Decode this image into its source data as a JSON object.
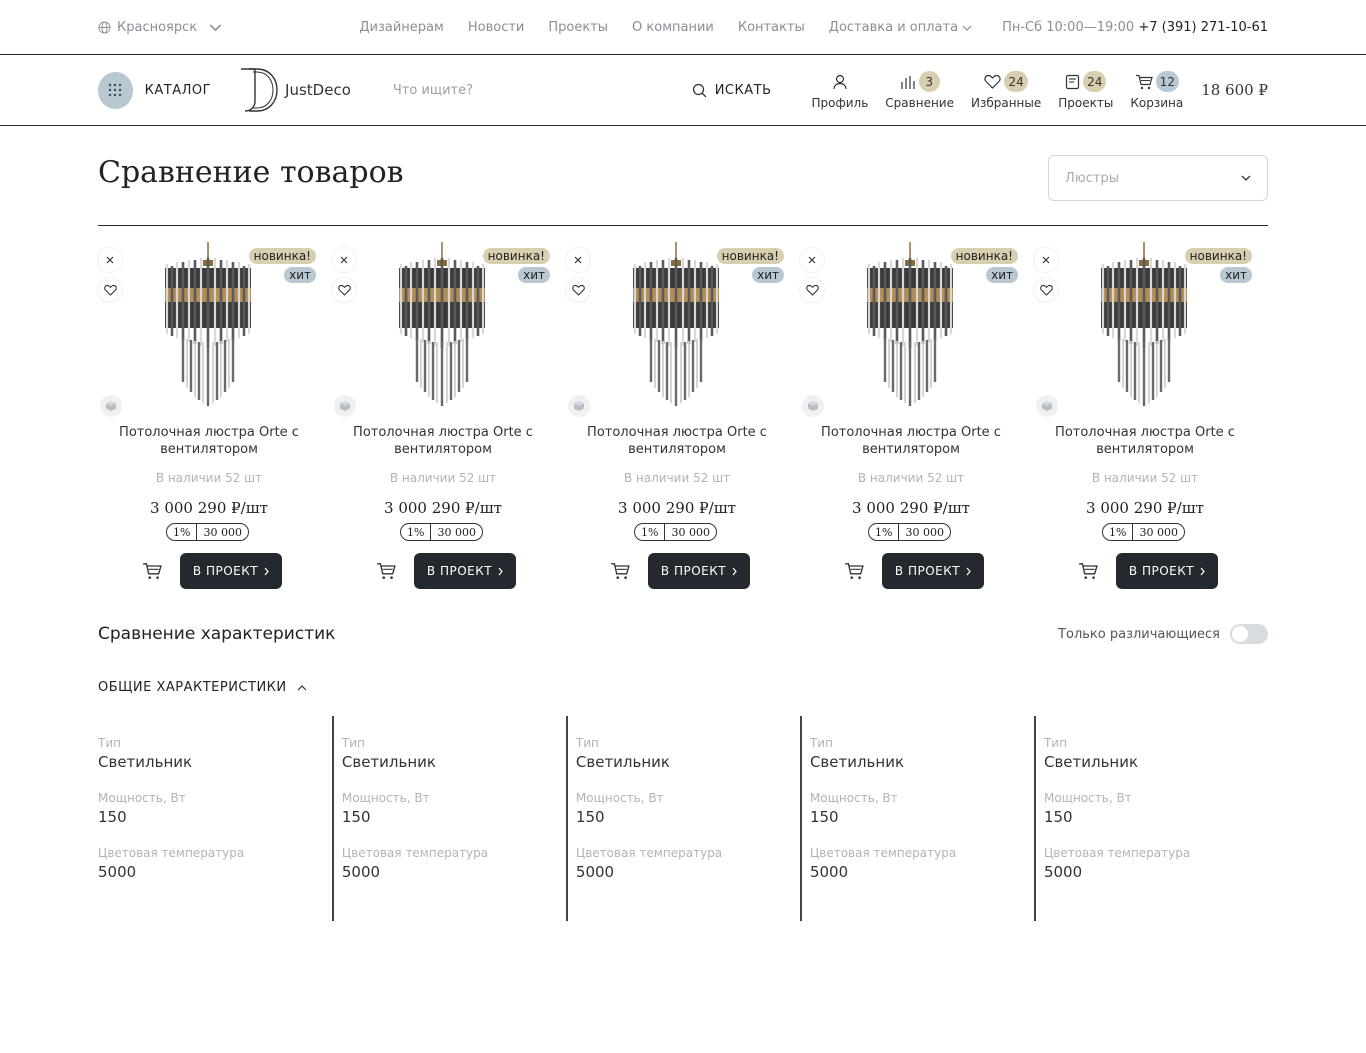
{
  "topbar": {
    "city": "Красноярск",
    "nav": [
      "Дизайнерам",
      "Новости",
      "Проекты",
      "О компании",
      "Контакты",
      "Доставка и оплата"
    ],
    "hours": "Пн-Сб 10:00—19:00",
    "phone": "+7 (391) 271-10-61"
  },
  "header": {
    "catalog_label": "КАТАЛОГ",
    "logo_text": "JustDeco",
    "search_placeholder": "Что ищите?",
    "search_button": "ИСКАТЬ",
    "icons": [
      {
        "label": "Профиль",
        "icon": "user-icon",
        "count": null
      },
      {
        "label": "Сравнение",
        "icon": "compare-icon",
        "count": "3"
      },
      {
        "label": "Избранные",
        "icon": "heart-icon",
        "count": "24"
      },
      {
        "label": "Проекты",
        "icon": "projects-icon",
        "count": "24"
      },
      {
        "label": "Корзина",
        "icon": "cart-icon",
        "count": "12"
      }
    ],
    "cart_sum": "18 600 ₽"
  },
  "page": {
    "title": "Сравнение товаров",
    "category_select": "Люстры"
  },
  "products": [
    {
      "name": "Потолочная люстра Orte с вентилятором",
      "stock": "В наличии 52 шт",
      "price": "3 000 290 ₽/шт",
      "bonus_pct": "1%",
      "bonus_val": "30 000",
      "tag_new": "новинка!",
      "tag_hit": "хит",
      "button": "В ПРОЕКТ"
    },
    {
      "name": "Потолочная люстра Orte с вентилятором",
      "stock": "В наличии 52 шт",
      "price": "3 000 290 ₽/шт",
      "bonus_pct": "1%",
      "bonus_val": "30 000",
      "tag_new": "новинка!",
      "tag_hit": "хит",
      "button": "В ПРОЕКТ"
    },
    {
      "name": "Потолочная люстра Orte с вентилятором",
      "stock": "В наличии 52 шт",
      "price": "3 000 290 ₽/шт",
      "bonus_pct": "1%",
      "bonus_val": "30 000",
      "tag_new": "новинка!",
      "tag_hit": "хит",
      "button": "В ПРОЕКТ"
    },
    {
      "name": "Потолочная люстра Orte с вентилятором",
      "stock": "В наличии 52 шт",
      "price": "3 000 290 ₽/шт",
      "bonus_pct": "1%",
      "bonus_val": "30 000",
      "tag_new": "новинка!",
      "tag_hit": "хит",
      "button": "В ПРОЕКТ"
    },
    {
      "name": "Потолочная люстра Orte с вентилятором",
      "stock": "В наличии 52 шт",
      "price": "3 000 290 ₽/шт",
      "bonus_pct": "1%",
      "bonus_val": "30 000",
      "tag_new": "новинка!",
      "tag_hit": "хит",
      "button": "В ПРОЕКТ"
    }
  ],
  "comparison": {
    "title": "Сравнение характеристик",
    "toggle_label": "Только различающиеся",
    "group_title": "ОБЩИЕ ХАРАКТЕРИСТИКИ",
    "columns": [
      [
        {
          "label": "Тип",
          "value": "Светильник"
        },
        {
          "label": "Мощность, Вт",
          "value": "150"
        },
        {
          "label": "Цветовая температура",
          "value": "5000"
        }
      ],
      [
        {
          "label": "Тип",
          "value": "Светильник"
        },
        {
          "label": "Мощность, Вт",
          "value": "150"
        },
        {
          "label": "Цветовая температура",
          "value": "5000"
        }
      ],
      [
        {
          "label": "Тип",
          "value": "Светильник"
        },
        {
          "label": "Мощность, Вт",
          "value": "150"
        },
        {
          "label": "Цветовая температура",
          "value": "5000"
        }
      ],
      [
        {
          "label": "Тип",
          "value": "Светильник"
        },
        {
          "label": "Мощность, Вт",
          "value": "150"
        },
        {
          "label": "Цветовая температура",
          "value": "5000"
        }
      ],
      [
        {
          "label": "Тип",
          "value": "Светильник"
        },
        {
          "label": "Мощность, Вт",
          "value": "150"
        },
        {
          "label": "Цветовая температура",
          "value": "5000"
        }
      ]
    ]
  },
  "colors": {
    "accent_beige": "#d7cfb0",
    "accent_blue": "#b8c8d3",
    "button_dark": "#24292f"
  }
}
